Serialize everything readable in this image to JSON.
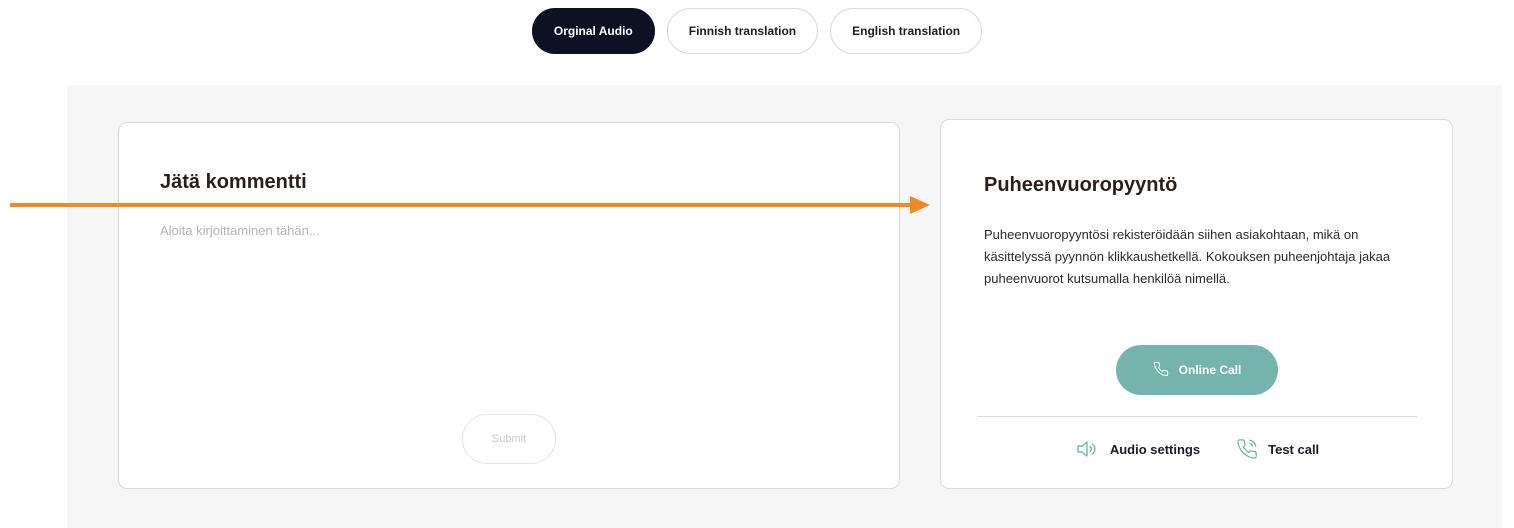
{
  "tabs": [
    {
      "label": "Orginal Audio",
      "active": true
    },
    {
      "label": "Finnish translation",
      "active": false
    },
    {
      "label": "English translation",
      "active": false
    }
  ],
  "comment": {
    "title": "Jätä kommentti",
    "placeholder": "Aloita kirjoittaminen tähän...",
    "submit_label": "Submit"
  },
  "speech_request": {
    "title": "Puheenvuoropyyntö",
    "description": "Puheenvuoropyyntösi rekisteröidään siihen asiakohtaan, mikä on käsittelyssä pyynnön klikkaushetkellä. Kokouksen puheenjohtaja jakaa puheenvuorot kutsumalla henkilöä nimellä.",
    "call_button_label": "Online Call",
    "call_icon": "phone-icon",
    "links": [
      {
        "label": "Audio settings",
        "icon": "speaker-icon"
      },
      {
        "label": "Test call",
        "icon": "phone-ringing-icon"
      }
    ]
  },
  "colors": {
    "active_tab": "#0e1124",
    "call_button": "#73b5ad",
    "annotation_arrow": "#f08a24",
    "panel_background": "#f6f6f6"
  }
}
